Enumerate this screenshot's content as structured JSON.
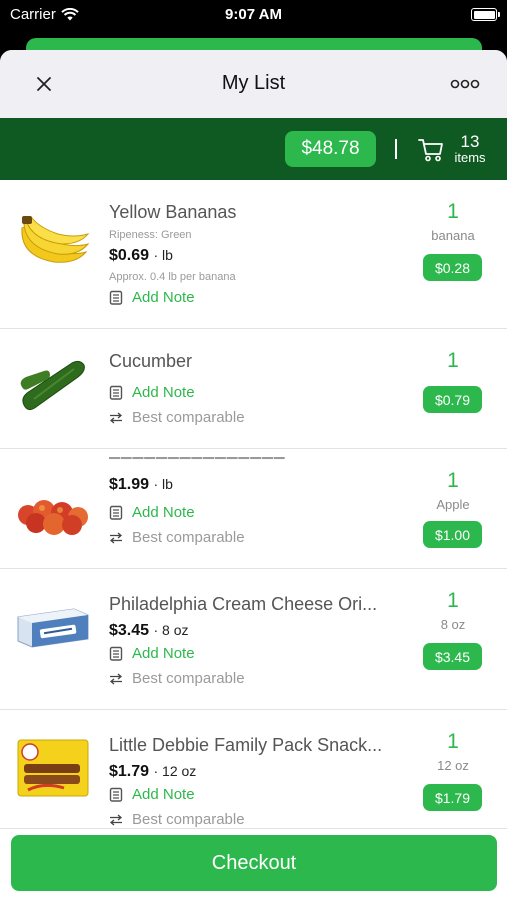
{
  "status_bar": {
    "carrier": "Carrier",
    "time": "9:07 AM"
  },
  "nav": {
    "title": "My List"
  },
  "summary": {
    "total": "$48.78",
    "item_count": "13",
    "item_label": "items"
  },
  "items": [
    {
      "name": "Yellow Bananas",
      "ripeness": "Ripeness: Green",
      "price": "$0.69",
      "price_unit": "· lb",
      "approx": "Approx. 0.4 lb per banana",
      "note": "Add Note",
      "qty": "1",
      "qty_unit": "banana",
      "line_price": "$0.28",
      "thumb_icon": "banana-icon"
    },
    {
      "name": "Cucumber",
      "note": "Add Note",
      "compare": "Best comparable",
      "qty": "1",
      "line_price": "$0.79",
      "thumb_icon": "cucumber-icon"
    },
    {
      "price": "$1.99",
      "price_unit": "· lb",
      "note": "Add Note",
      "compare": "Best comparable",
      "qty": "1",
      "qty_unit": "Apple",
      "line_price": "$1.00",
      "thumb_icon": "apples-icon"
    },
    {
      "name": "Philadelphia Cream Cheese Ori...",
      "price": "$3.45",
      "price_unit": "· 8 oz",
      "note": "Add Note",
      "compare": "Best comparable",
      "qty": "1",
      "qty_unit": "8 oz",
      "line_price": "$3.45",
      "thumb_icon": "cream-cheese-icon"
    },
    {
      "name": "Little Debbie Family Pack Snack...",
      "price": "$1.79",
      "price_unit": "· 12 oz",
      "note": "Add Note",
      "compare": "Best comparable",
      "qty": "1",
      "qty_unit": "12 oz",
      "line_price": "$1.79",
      "thumb_icon": "snack-box-icon"
    }
  ],
  "checkout": {
    "label": "Checkout"
  },
  "colors": {
    "accent": "#2db84d",
    "summary_bg": "#0f5a22",
    "nav_bg": "#efeff4"
  }
}
